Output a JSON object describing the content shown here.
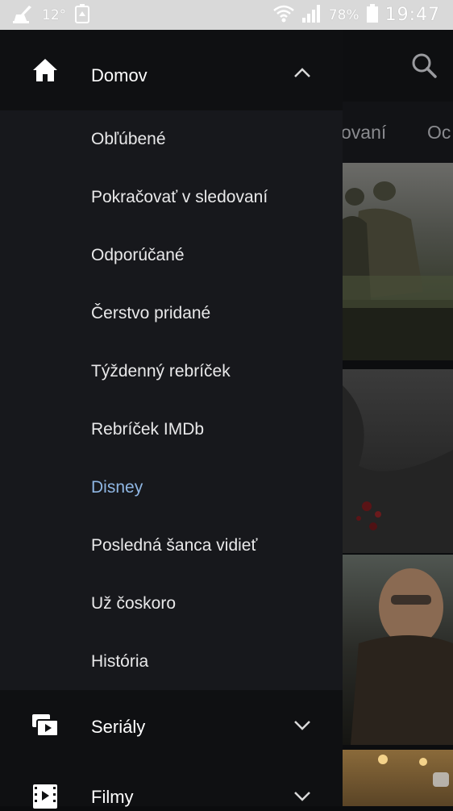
{
  "status_bar": {
    "temperature": "12°",
    "battery_percent": "78%",
    "clock": "19:47",
    "icons": [
      "cleaner-icon",
      "recycle-icon",
      "wifi-icon",
      "signal-icon",
      "battery-icon"
    ]
  },
  "background": {
    "tabs": [
      "ovaní",
      "Oc"
    ],
    "search_icon": "search-icon"
  },
  "drawer": {
    "sections": [
      {
        "label": "Domov",
        "icon": "home-icon",
        "expanded": true,
        "items": [
          {
            "label": "Obľúbené"
          },
          {
            "label": "Pokračovať v sledovaní"
          },
          {
            "label": "Odporúčané"
          },
          {
            "label": "Čerstvo pridané"
          },
          {
            "label": "Týždenný rebríček"
          },
          {
            "label": "Rebríček IMDb"
          },
          {
            "label": "Disney",
            "active": true
          },
          {
            "label": "Posledná šanca vidieť"
          },
          {
            "label": "Už čoskoro"
          },
          {
            "label": "História"
          }
        ]
      },
      {
        "label": "Seriály",
        "icon": "series-icon",
        "expanded": false
      },
      {
        "label": "Filmy",
        "icon": "film-icon",
        "expanded": false
      }
    ]
  },
  "colors": {
    "drawer_bg": "#17181c",
    "section_bg": "#0f1012",
    "active_item": "#8fb6e3"
  }
}
